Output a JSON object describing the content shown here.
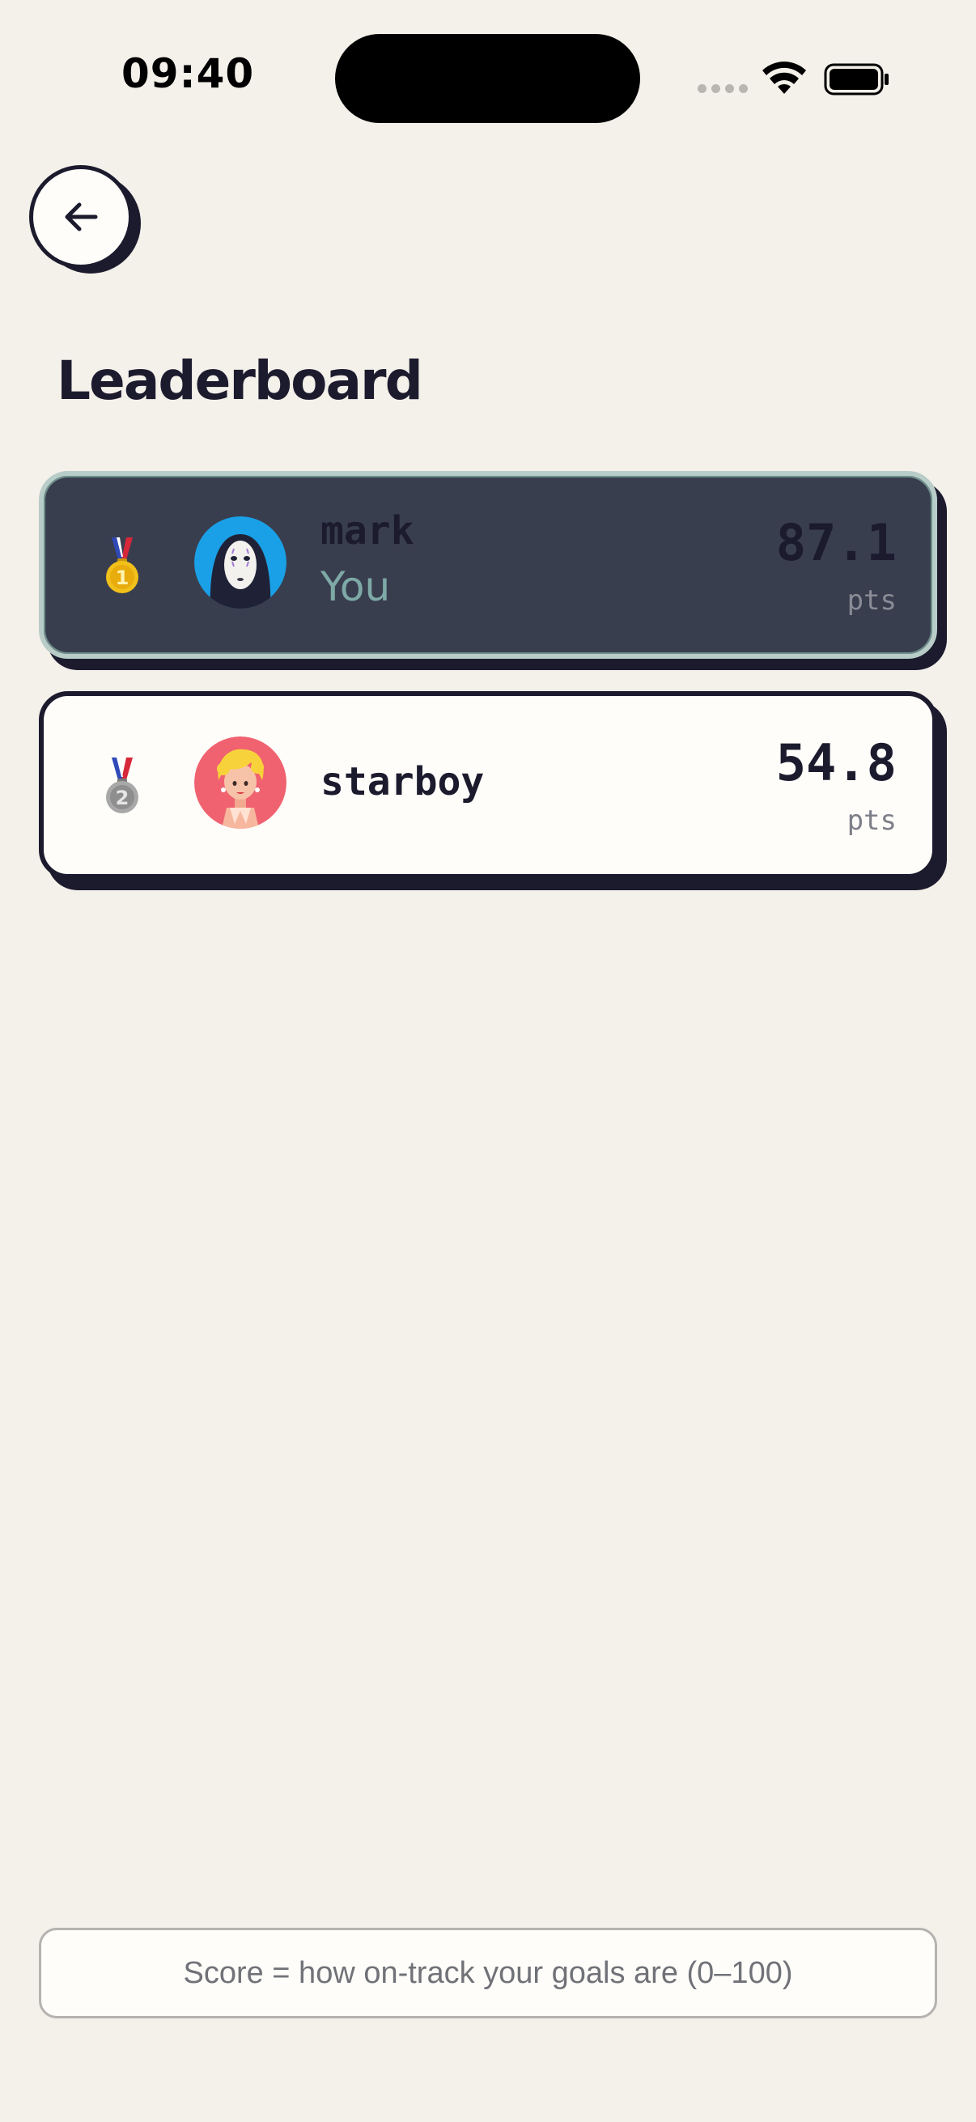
{
  "status_bar": {
    "time": "09:40",
    "icons": [
      "cellular-signal-icon",
      "wifi-icon",
      "battery-icon"
    ]
  },
  "header": {
    "back_icon": "arrow-left-icon",
    "title": "Leaderboard"
  },
  "leaderboard": {
    "entries": [
      {
        "rank": 1,
        "medal": "gold-medal-icon",
        "avatar": "no-face-avatar",
        "name": "mark",
        "tag": "You",
        "score": "87.1",
        "unit": "pts",
        "is_current_user": true
      },
      {
        "rank": 2,
        "medal": "silver-medal-icon",
        "avatar": "blonde-woman-avatar",
        "name": "starboy",
        "score": "54.8",
        "unit": "pts",
        "is_current_user": false
      }
    ]
  },
  "footer": {
    "note": "Score = how on-track your goals are (0–100)"
  },
  "colors": {
    "background": "#f4f0ea",
    "ink": "#1c1b2e",
    "current_user_card": "#393e4f",
    "current_user_outline": "#b8ccc8",
    "you_label": "#7ea9a6",
    "card_surface": "#fefdf9",
    "gold": "#f2c01a",
    "silver": "#9a9a9a"
  }
}
